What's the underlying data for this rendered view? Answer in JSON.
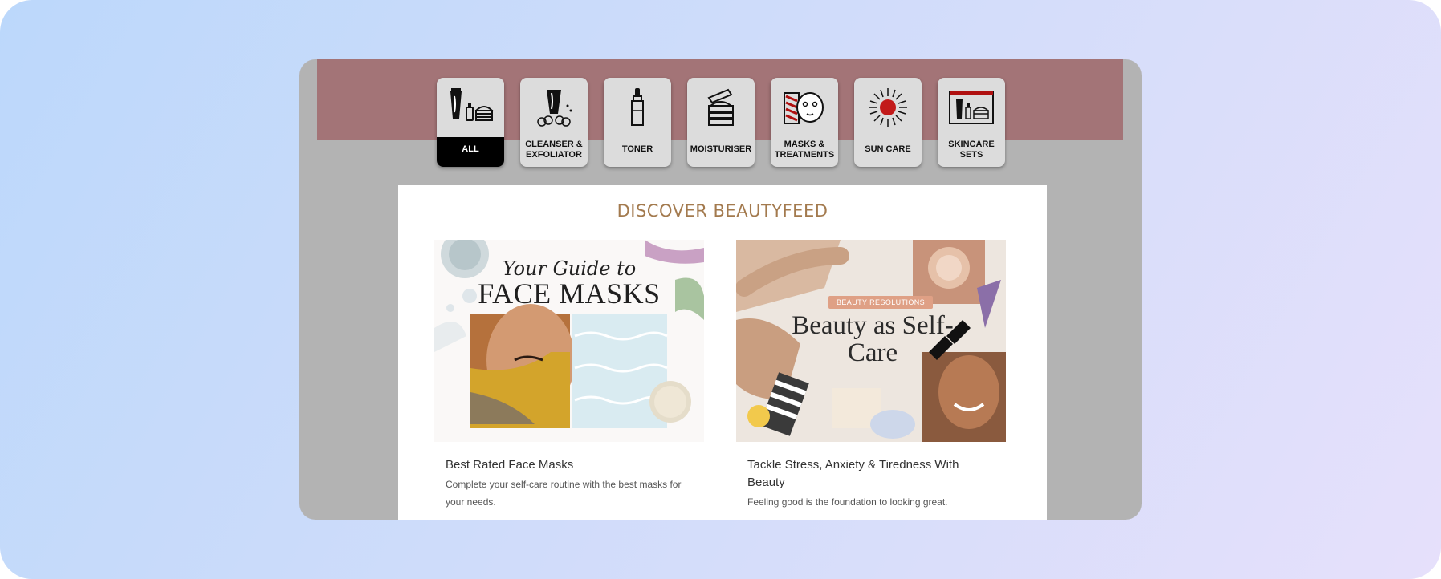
{
  "categories": [
    {
      "label": "ALL",
      "icon": "all-products-icon",
      "active": true
    },
    {
      "label": "CLEANSER &\nEXFOLIATOR",
      "icon": "cleanser-tube-icon",
      "active": false
    },
    {
      "label": "TONER",
      "icon": "toner-bottle-icon",
      "active": false
    },
    {
      "label": "MOISTURISER",
      "icon": "moisturiser-jar-icon",
      "active": false
    },
    {
      "label": "MASKS &\nTREATMENTS",
      "icon": "face-mask-icon",
      "active": false
    },
    {
      "label": "SUN CARE",
      "icon": "sun-icon",
      "active": false
    },
    {
      "label": "SKINCARE\nSETS",
      "icon": "skincare-set-box-icon",
      "active": false
    }
  ],
  "feed": {
    "title": "DISCOVER BEAUTYFEED",
    "cards": [
      {
        "image_heading_line1": "Your Guide to",
        "image_heading_line2": "FACE MASKS",
        "title": "Best Rated Face Masks",
        "description": "Complete your self-care routine with the best masks for your needs."
      },
      {
        "image_badge": "BEAUTY RESOLUTIONS",
        "image_heading": "Beauty as Self-Care",
        "title": "Tackle Stress, Anxiety & Tiredness With Beauty",
        "description": "Feeling good is the foundation to looking great."
      }
    ]
  },
  "colors": {
    "band": "#a37477",
    "window": "#b3b3b3",
    "accent_title": "#a37a4e",
    "active_tab": "#000000"
  }
}
